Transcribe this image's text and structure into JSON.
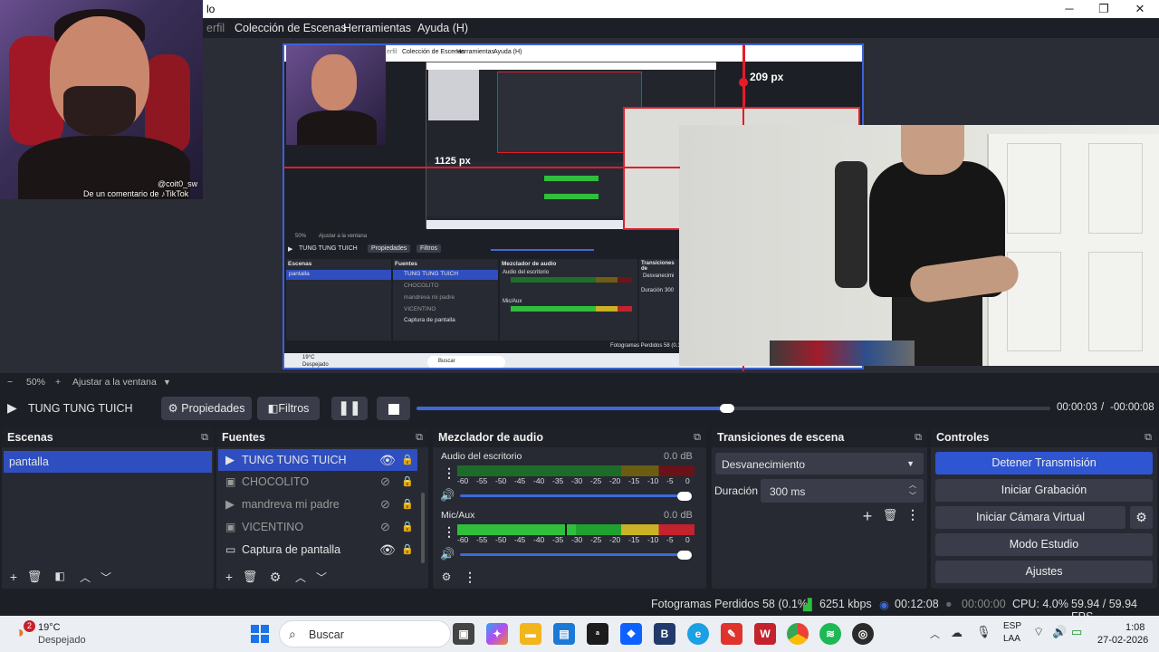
{
  "titlebar": {
    "title": "lo",
    "minimize": "─",
    "maximize": "❐",
    "close": "✕"
  },
  "menu": {
    "items": [
      "erfil",
      "Colección de Escenas",
      "Herramientas",
      "Ayuda (H)"
    ]
  },
  "preview": {
    "webcam_caption_user": "@coit0_sw",
    "webcam_caption_tiktok": "De un comentario de ♪TikTok",
    "measure_top": "209 px",
    "measure_left": "1125 px",
    "nested_menu": [
      "erfil",
      "Colección de Escenas",
      "Herramientas",
      "Ayuda (H)"
    ],
    "nested_labels": {
      "source": "TUNG TUNG TUICH",
      "props": "Propiedades",
      "filters": "Filtros",
      "scenes": "Escenas",
      "sources": "Fuentes",
      "mixer": "Mezclador de audio",
      "trans": "Transiciones de",
      "scene_item": "pantalla",
      "src1": "TUNG TUNG TUICH",
      "src2": "CHOCOLITO",
      "src3": "mandreva mi padre",
      "src4": "VICENTINO",
      "src5": "Captura de pantalla",
      "a1": "Audio del escritorio",
      "a2": "Mic/Aux",
      "trans_val": "Desvanecimi",
      "dur": "Duración",
      "dur_val": "300",
      "zoom": "50%",
      "fit": "Ajustar a la ventana",
      "frames": "Fotogramas Perdidos 58 (0.1%",
      "temp": "19°C",
      "weather": "Despejado",
      "search": "Buscar"
    }
  },
  "zoom": {
    "minus": "−",
    "value": "50%",
    "plus": "+",
    "fit": "Ajustar a la ventana"
  },
  "sourcebar": {
    "source_name": "TUNG TUNG TUICH",
    "properties": "Propiedades",
    "filters": "Filtros",
    "time_current": "00:00:03",
    "time_sep": "/",
    "time_remaining": "-00:00:08",
    "progress": 0.49
  },
  "scenes": {
    "title": "Escenas",
    "items": [
      "pantalla"
    ]
  },
  "sources": {
    "title": "Fuentes",
    "items": [
      "TUNG TUNG TUICH",
      "CHOCOLITO",
      "mandreva mi padre",
      "VICENTINO",
      "Captura de pantalla"
    ]
  },
  "mixer": {
    "title": "Mezclador de audio",
    "channels": [
      {
        "name": "Audio del escritorio",
        "db": "0.0 dB",
        "level": 0.0,
        "volume": 1.0
      },
      {
        "name": "Mic/Aux",
        "db": "0.0 dB",
        "level": 0.76,
        "volume": 1.0
      }
    ],
    "ticks": [
      "-60",
      "-55",
      "-50",
      "-45",
      "-40",
      "-35",
      "-30",
      "-25",
      "-20",
      "-15",
      "-10",
      "-5",
      "0"
    ]
  },
  "transitions": {
    "title": "Transiciones de escena",
    "selected": "Desvanecimiento",
    "duration_label": "Duración",
    "duration_value": "300 ms"
  },
  "controls": {
    "title": "Controles",
    "items": [
      "Detener Transmisión",
      "Iniciar Grabación",
      "Iniciar Cámara Virtual",
      "Modo Estudio",
      "Ajustes"
    ]
  },
  "status": {
    "frames": "Fotogramas Perdidos 58 (0.1%)",
    "kbps": "6251 kbps",
    "stream_time": "00:12:08",
    "rec_time": "00:00:00",
    "cpu": "CPU: 4.0%",
    "fps": "59.94 / 59.94 FPS"
  },
  "taskbar": {
    "temp": "19°C",
    "weather": "Despejado",
    "badge": "2",
    "search": "Buscar",
    "lang1": "ESP",
    "lang2": "LAA",
    "time": "1:08",
    "date": "27-02-2026"
  },
  "colors": {
    "accent": "#3c62d8",
    "selection": "#2f4fc0",
    "meter_green": "#2fbf3c",
    "meter_yellow": "#c9b226",
    "meter_red": "#c4222c",
    "red_guide": "#e21c2a"
  }
}
